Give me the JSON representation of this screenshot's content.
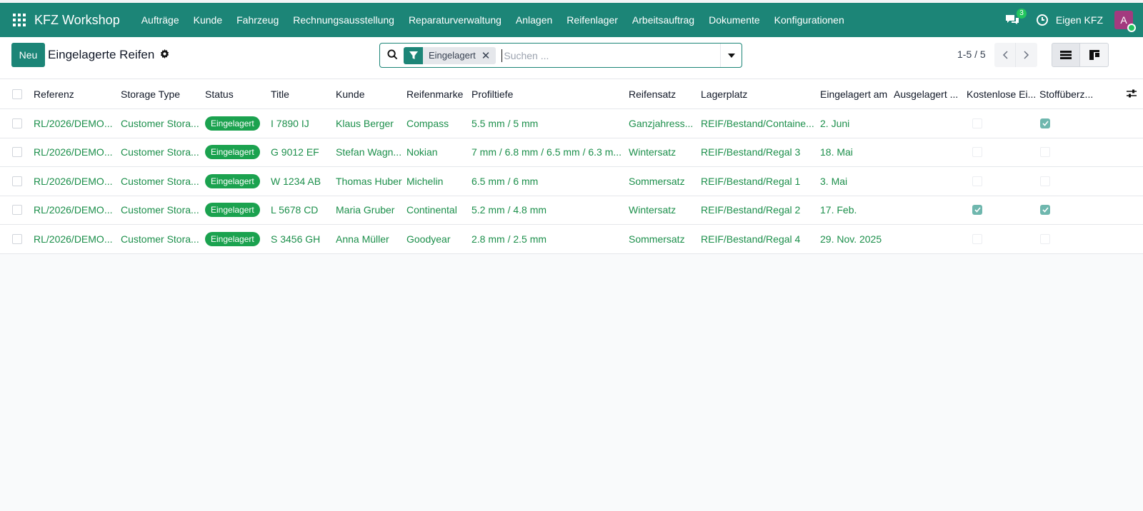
{
  "navbar": {
    "brand": "KFZ Workshop",
    "menu": [
      "Aufträge",
      "Kunde",
      "Fahrzeug",
      "Rechnungsausstellung",
      "Reparaturverwaltung",
      "Anlagen",
      "Reifenlager",
      "Arbeitsauftrag",
      "Dokumente",
      "Konfigurationen"
    ],
    "chat_count": "3",
    "company": "Eigen KFZ",
    "avatar_letter": "A",
    "colors": {
      "bar": "#1c8577",
      "avatar": "#a33a7f"
    }
  },
  "control": {
    "new_label": "Neu",
    "title": "Eingelagerte Reifen",
    "facet_label": "Eingelagert",
    "search_placeholder": "Suchen ...",
    "pager": "1-5 / 5"
  },
  "table": {
    "headers": [
      "Referenz",
      "Storage Type",
      "Status",
      "Title",
      "Kunde",
      "Reifenmarke",
      "Profiltiefe",
      "Reifensatz",
      "Lagerplatz",
      "Eingelagert am",
      "Ausgelagert ...",
      "Kostenlose Ei...",
      "Stoffüberz..."
    ],
    "rows": [
      {
        "ref": "RL/2026/DEMO...",
        "storage": "Customer Stora...",
        "status": "Eingelagert",
        "title": "I 7890 IJ",
        "kunde": "Klaus Berger",
        "marke": "Compass",
        "profil": "5.5 mm / 5 mm",
        "satz": "Ganzjahress...",
        "lager": "REIF/Bestand/Containe...",
        "ein": "2. Juni",
        "aus": "",
        "kostenlos": false,
        "stoff": true
      },
      {
        "ref": "RL/2026/DEMO...",
        "storage": "Customer Stora...",
        "status": "Eingelagert",
        "title": "G 9012 EF",
        "kunde": "Stefan Wagn...",
        "marke": "Nokian",
        "profil": "7 mm / 6.8 mm / 6.5 mm / 6.3 m...",
        "satz": "Wintersatz",
        "lager": "REIF/Bestand/Regal 3",
        "ein": "18. Mai",
        "aus": "",
        "kostenlos": false,
        "stoff": false
      },
      {
        "ref": "RL/2026/DEMO...",
        "storage": "Customer Stora...",
        "status": "Eingelagert",
        "title": "W 1234 AB",
        "kunde": "Thomas Huber",
        "marke": "Michelin",
        "profil": "6.5 mm / 6 mm",
        "satz": "Sommersatz",
        "lager": "REIF/Bestand/Regal 1",
        "ein": "3. Mai",
        "aus": "",
        "kostenlos": false,
        "stoff": false
      },
      {
        "ref": "RL/2026/DEMO...",
        "storage": "Customer Stora...",
        "status": "Eingelagert",
        "title": "L 5678 CD",
        "kunde": "Maria Gruber",
        "marke": "Continental",
        "profil": "5.2 mm / 4.8 mm",
        "satz": "Wintersatz",
        "lager": "REIF/Bestand/Regal 2",
        "ein": "17. Feb.",
        "aus": "",
        "kostenlos": true,
        "stoff": true
      },
      {
        "ref": "RL/2026/DEMO...",
        "storage": "Customer Stora...",
        "status": "Eingelagert",
        "title": "S 3456 GH",
        "kunde": "Anna Müller",
        "marke": "Goodyear",
        "profil": "2.8 mm / 2.5 mm",
        "satz": "Sommersatz",
        "lager": "REIF/Bestand/Regal 4",
        "ein": "29. Nov. 2025",
        "aus": "",
        "kostenlos": false,
        "stoff": false
      }
    ]
  }
}
